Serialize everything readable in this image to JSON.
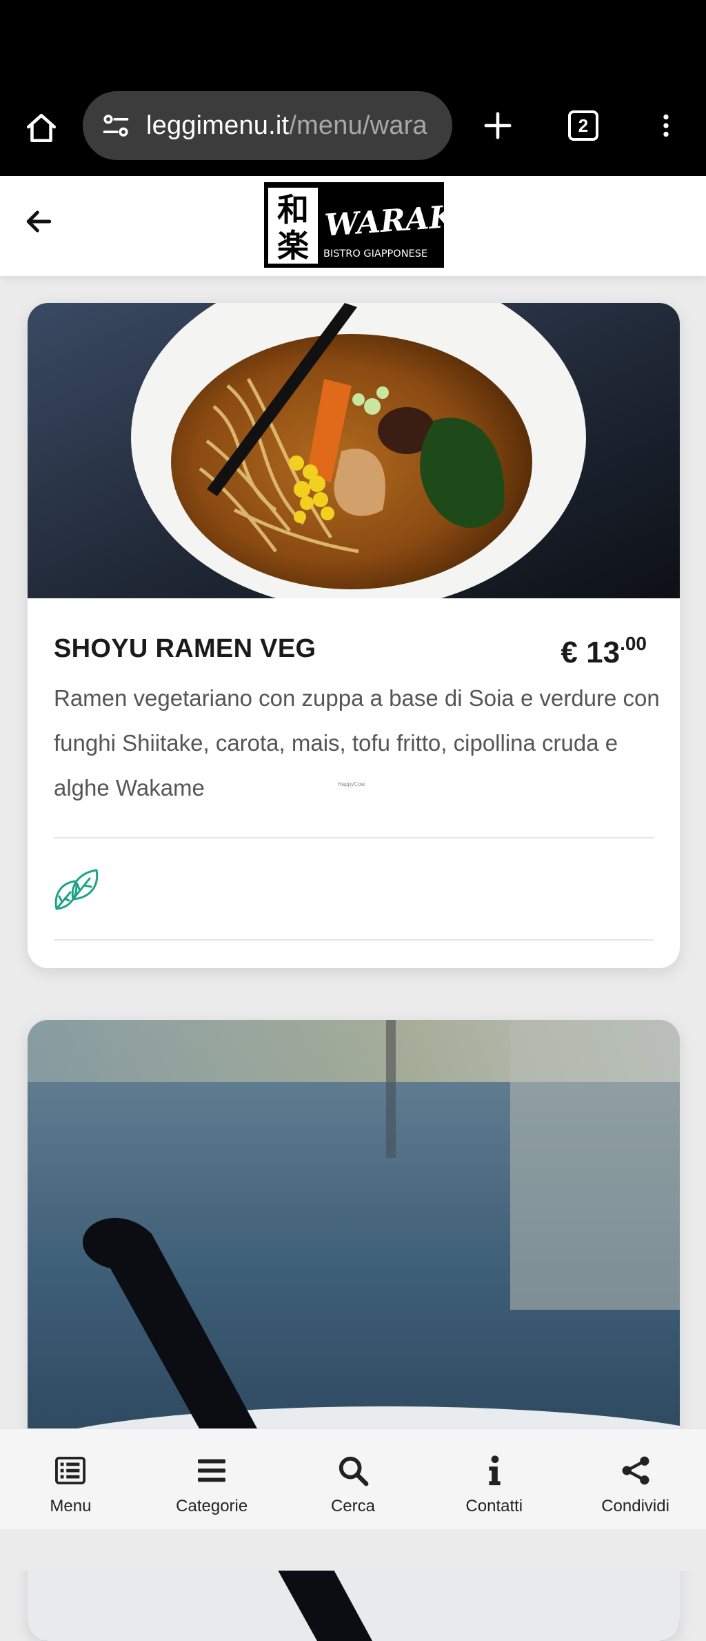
{
  "browser": {
    "url_domain": "leggimenu.it",
    "url_path": "/menu/wara",
    "tab_count": "2",
    "icons": [
      "home-icon",
      "site-settings-icon",
      "plus-icon",
      "tabs-icon",
      "more-vert-icon"
    ]
  },
  "header": {
    "logo_alt": "Waraku Bistro Giapponese",
    "logo_text": "WARAKU",
    "logo_subtitle": "BISTRO GIAPPONESE",
    "logo_kanji": [
      "和",
      "楽"
    ]
  },
  "menu_items": [
    {
      "title": "SHOYU RAMEN VEG",
      "price_main": "€ 13",
      "price_cents": ".00",
      "description": "Ramen vegetariano con zuppa a base di Soia e verdure con funghi Shiitake, carota, mais, tofu fritto, cipollina cruda e alghe Wakame",
      "watermark": "HappyCow",
      "tag_icon": "vegan-leaf-icon"
    }
  ],
  "bottom_nav": [
    {
      "label": "Menu",
      "icon": "list-icon"
    },
    {
      "label": "Categorie",
      "icon": "hamburger-icon"
    },
    {
      "label": "Cerca",
      "icon": "search-icon"
    },
    {
      "label": "Contatti",
      "icon": "info-icon"
    },
    {
      "label": "Condividi",
      "icon": "share-icon"
    }
  ],
  "colors": {
    "chrome_bg": "#000000",
    "url_box_bg": "#3c3c3c",
    "page_bg": "#ebebeb",
    "card_bg": "#ffffff",
    "vegan_icon": "#1aa389",
    "text_dark": "#1a1a1a",
    "text_muted": "#555555"
  }
}
